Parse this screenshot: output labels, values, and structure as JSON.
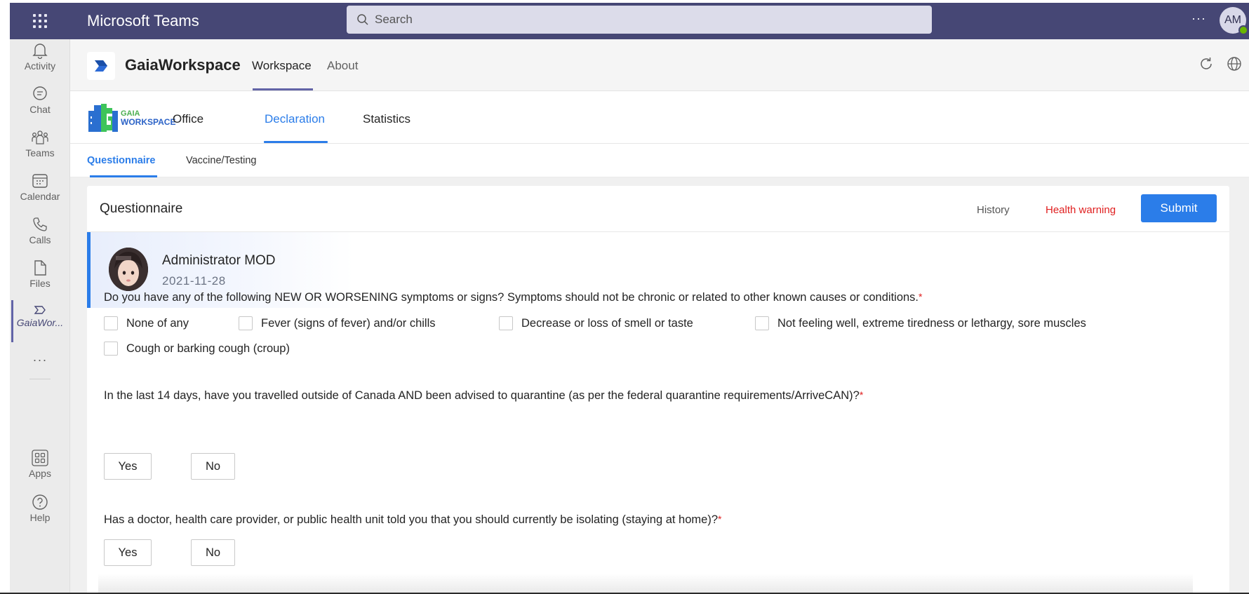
{
  "topbar": {
    "title": "Microsoft Teams",
    "search_placeholder": "Search",
    "more": "···",
    "avatar_initials": "AM",
    "bg_color": "#464775"
  },
  "rail": {
    "items": [
      {
        "label": "Activity",
        "icon": "bell-icon"
      },
      {
        "label": "Chat",
        "icon": "chat-icon"
      },
      {
        "label": "Teams",
        "icon": "teams-icon"
      },
      {
        "label": "Calendar",
        "icon": "calendar-icon"
      },
      {
        "label": "Calls",
        "icon": "phone-icon"
      },
      {
        "label": "Files",
        "icon": "file-icon"
      },
      {
        "label": "GaiaWor...",
        "icon": "gaia-app-icon"
      }
    ],
    "more": "···",
    "apps_label": "Apps",
    "help_label": "Help"
  },
  "app_header": {
    "name": "GaiaWorkspace",
    "tabs": [
      {
        "label": "Workspace",
        "active": true
      },
      {
        "label": "About",
        "active": false
      }
    ]
  },
  "module_nav": {
    "logo_top": "GAIA",
    "logo_bottom": "WORKSPACE",
    "tabs": [
      {
        "label": "Office",
        "active": false
      },
      {
        "label": "Declaration",
        "active": true
      },
      {
        "label": "Statistics",
        "active": false
      }
    ],
    "accent": "#2b7de9"
  },
  "subtabs": [
    {
      "label": "Questionnaire",
      "active": true
    },
    {
      "label": "Vaccine/Testing",
      "active": false
    }
  ],
  "card": {
    "title": "Questionnaire",
    "history": "History",
    "health_warning": "Health warning",
    "submit": "Submit",
    "profile": {
      "name": "Administrator MOD",
      "date": "2021-11-28"
    },
    "questions": [
      {
        "text": "Do you have any of the following NEW OR WORSENING symptoms or signs? Symptoms should not be chronic or related to other known causes or conditions.",
        "required": "*",
        "options": [
          "None of any",
          "Fever (signs of fever) and/or chills",
          "Decrease or loss of smell or taste",
          "Not feeling well, extreme tiredness or lethargy, sore muscles",
          "Cough or barking cough (croup)"
        ]
      },
      {
        "text": "In the last 14 days, have you travelled outside of Canada AND been advised to quarantine (as per the federal quarantine requirements/ArriveCAN)?",
        "required": "*",
        "yes": "Yes",
        "no": "No"
      },
      {
        "text": "Has a doctor, health care provider, or public health unit told you that you should currently be isolating (staying at home)?",
        "required": "*",
        "yes": "Yes",
        "no": "No"
      }
    ]
  }
}
